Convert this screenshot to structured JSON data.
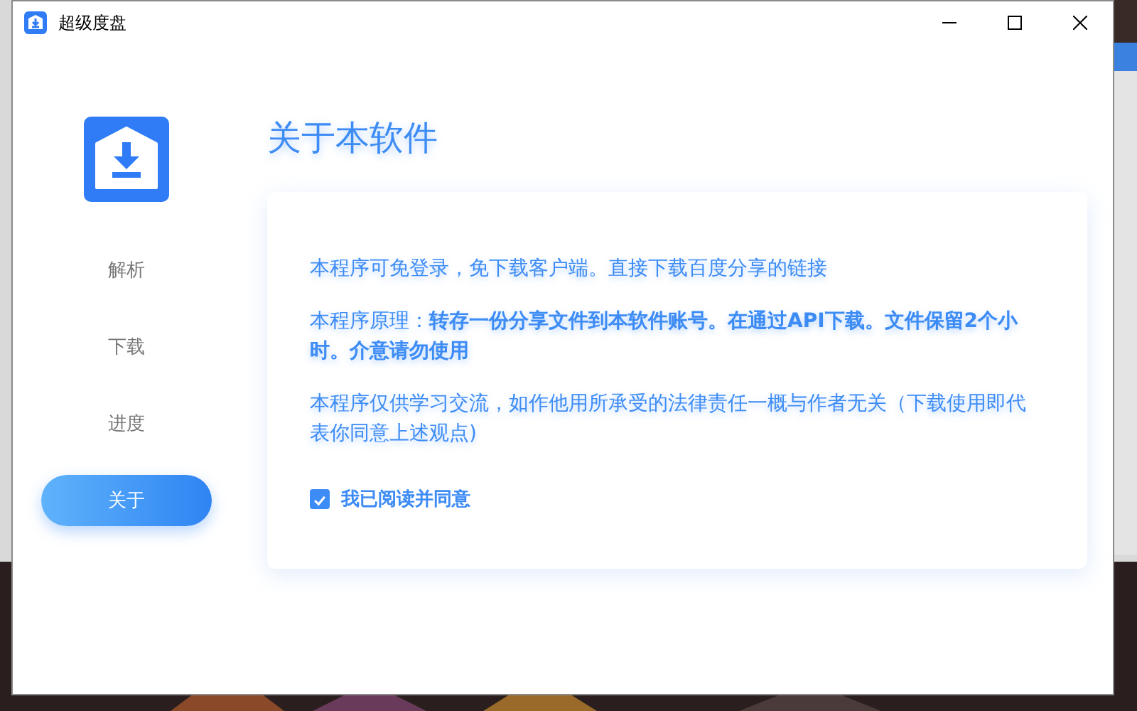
{
  "window": {
    "title": "超级度盘"
  },
  "nav": [
    {
      "label": "解析",
      "selected": false
    },
    {
      "label": "下载",
      "selected": false
    },
    {
      "label": "进度",
      "selected": false
    },
    {
      "label": "关于",
      "selected": true
    }
  ],
  "heading": "关于本软件",
  "paragraphs": [
    "本程序可免登录，免下载客户端。直接下载百度分享的链接",
    "本程序原理：**转存一份分享文件到本软件账号。在通过API下载。文件保留2个小时。介意请勿使用**",
    "本程序仅供学习交流，如作他用所承受的法律责任一概与作者无关（下载使用即代表你同意上述观点)"
  ],
  "agree": {
    "label": "我已阅读并同意",
    "checked": true
  }
}
